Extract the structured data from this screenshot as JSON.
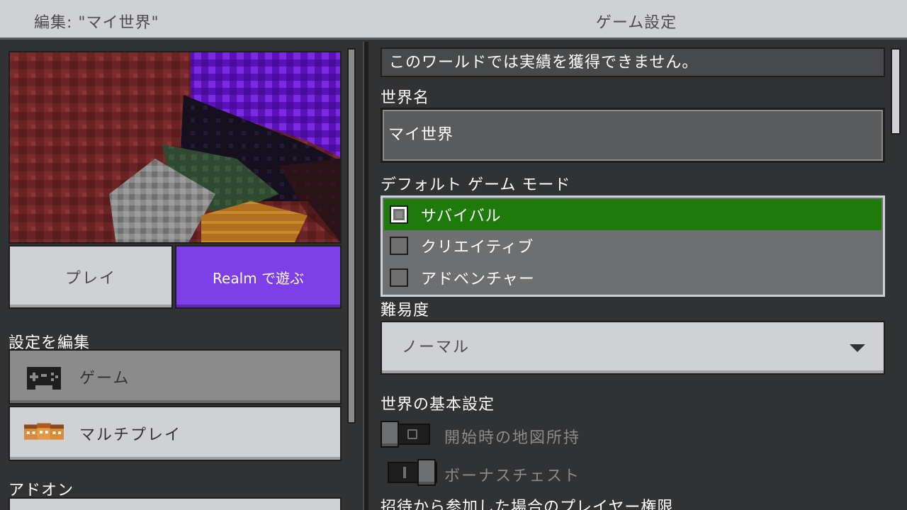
{
  "header": {
    "edit_title": "編集: \"マイ世界\"",
    "page_title": "ゲーム設定"
  },
  "left": {
    "play_label": "プレイ",
    "realm_label": "Realm で遊ぶ",
    "edit_settings_heading": "設定を編集",
    "menu": [
      {
        "label": "ゲーム",
        "icon": "controller-icon",
        "active": true
      },
      {
        "label": "マルチプレイ",
        "icon": "multiplayer-icon",
        "active": false
      }
    ],
    "addons_heading": "アドオン"
  },
  "right": {
    "achievement_notice": "このワールドでは実績を獲得できません。",
    "world_name_label": "世界名",
    "world_name_value": "マイ世界",
    "game_mode_label": "デフォルト ゲーム モード",
    "game_modes": [
      {
        "label": "サバイバル",
        "selected": true
      },
      {
        "label": "クリエイティブ",
        "selected": false
      },
      {
        "label": "アドベンチャー",
        "selected": false
      }
    ],
    "difficulty_label": "難易度",
    "difficulty_value": "ノーマル",
    "world_basics_heading": "世界の基本設定",
    "toggles": [
      {
        "label": "開始時の地図所持",
        "on": false
      },
      {
        "label": "ボーナスチェスト",
        "on": true
      }
    ],
    "invite_permission_heading": "招待から参加した場合のプレイヤー権限"
  },
  "colors": {
    "selected_green": "#1f7a0c",
    "realm_purple": "#7d3fe8",
    "panel_dark": "#313233",
    "button_light": "#d0d1d4"
  }
}
